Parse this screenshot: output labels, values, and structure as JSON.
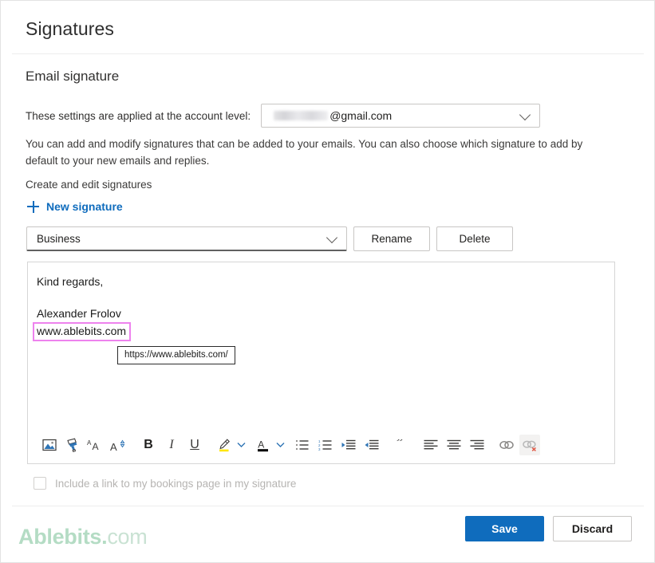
{
  "header": {
    "title": "Signatures"
  },
  "section": {
    "title": "Email signature",
    "account_label": "These settings are applied at the account level:",
    "account_value": "@gmail.com",
    "account_redacted": true,
    "description": "You can add and modify signatures that can be added to your emails. You can also choose which signature to add by default to your new emails and replies.",
    "create_label": "Create and edit signatures",
    "new_signature_label": "New signature"
  },
  "signature_picker": {
    "selected": "Business",
    "rename_label": "Rename",
    "delete_label": "Delete"
  },
  "editor": {
    "lines": [
      "Kind regards,",
      "Alexander Frolov"
    ],
    "link_text": "www.ablebits.com",
    "tooltip": "https://www.ablebits.com/"
  },
  "toolbar": {
    "items": [
      {
        "name": "insert-picture-icon",
        "label": "Insert picture"
      },
      {
        "name": "format-painter-icon",
        "label": "Format painter"
      },
      {
        "name": "font-size-icon",
        "label": "Font size"
      },
      {
        "name": "font-grow-shrink-icon",
        "label": "Increase/decrease font size"
      },
      {
        "name": "bold-icon",
        "label": "B"
      },
      {
        "name": "italic-icon",
        "label": "I"
      },
      {
        "name": "underline-icon",
        "label": "U"
      },
      {
        "name": "highlight-icon",
        "label": "Text highlight color"
      },
      {
        "name": "font-color-icon",
        "label": "Font color"
      },
      {
        "name": "bulleted-list-icon",
        "label": "Bulleted list"
      },
      {
        "name": "numbered-list-icon",
        "label": "Numbered list"
      },
      {
        "name": "decrease-indent-icon",
        "label": "Decrease indent"
      },
      {
        "name": "increase-indent-icon",
        "label": "Increase indent"
      },
      {
        "name": "quote-icon",
        "label": "Quote"
      },
      {
        "name": "align-left-icon",
        "label": "Align left"
      },
      {
        "name": "align-center-icon",
        "label": "Align center"
      },
      {
        "name": "align-right-icon",
        "label": "Align right"
      },
      {
        "name": "insert-link-icon",
        "label": "Insert link"
      },
      {
        "name": "remove-link-icon",
        "label": "Remove link"
      }
    ]
  },
  "bookings": {
    "checkbox_label": "Include a link to my bookings page in my signature",
    "checked": false,
    "disabled": true
  },
  "footer": {
    "save_label": "Save",
    "discard_label": "Discard",
    "watermark_bold": "Ablebits",
    "watermark_dot": ".",
    "watermark_thin": "com"
  },
  "colors": {
    "accent": "#0f6cbd",
    "link_highlight": "#ee82ee",
    "watermark": "#b4dcc4",
    "highlight_yellow": "#ffe600"
  }
}
